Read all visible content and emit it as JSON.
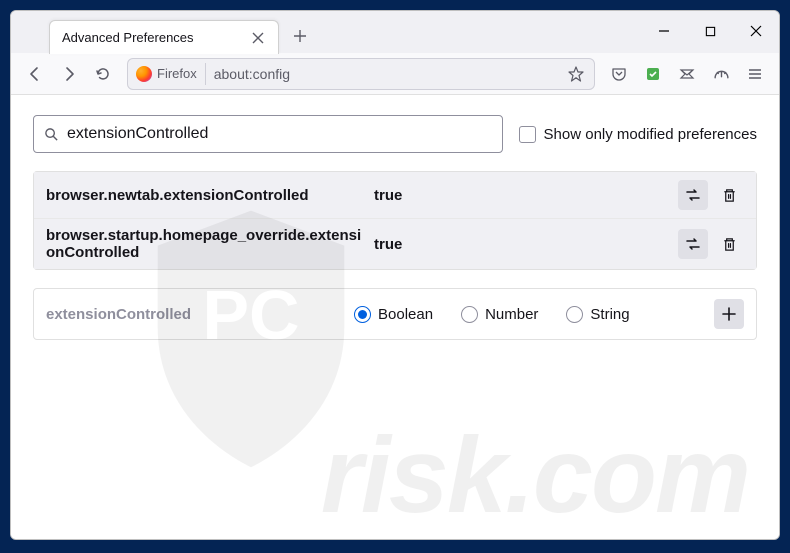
{
  "tab": {
    "title": "Advanced Preferences"
  },
  "urlbar": {
    "identity": "Firefox",
    "url": "about:config"
  },
  "search": {
    "value": "extensionControlled",
    "show_only_modified_label": "Show only modified preferences"
  },
  "prefs": [
    {
      "name": "browser.newtab.extensionControlled",
      "value": "true"
    },
    {
      "name": "browser.startup.homepage_override.extensionControlled",
      "value": "true"
    }
  ],
  "new_pref": {
    "name": "extensionControlled",
    "types": [
      "Boolean",
      "Number",
      "String"
    ],
    "selected": "Boolean"
  },
  "watermark": "risk.com"
}
